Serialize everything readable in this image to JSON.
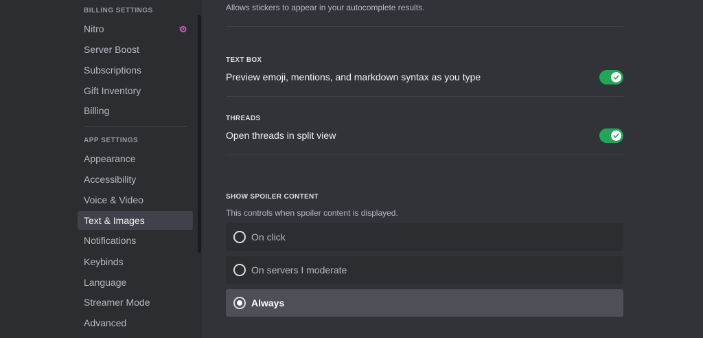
{
  "sidebar": {
    "billing_header": "BILLING SETTINGS",
    "billing_items": [
      {
        "label": "Nitro"
      },
      {
        "label": "Server Boost"
      },
      {
        "label": "Subscriptions"
      },
      {
        "label": "Gift Inventory"
      },
      {
        "label": "Billing"
      }
    ],
    "app_header": "APP SETTINGS",
    "app_items": [
      {
        "label": "Appearance"
      },
      {
        "label": "Accessibility"
      },
      {
        "label": "Voice & Video"
      },
      {
        "label": "Text & Images"
      },
      {
        "label": "Notifications"
      },
      {
        "label": "Keybinds"
      },
      {
        "label": "Language"
      },
      {
        "label": "Streamer Mode"
      },
      {
        "label": "Advanced"
      }
    ],
    "selected": "Text & Images",
    "nitro_icon": "nitro-icon"
  },
  "main": {
    "stickers_hint": "Allows stickers to appear in your autocomplete results.",
    "text_box": {
      "heading": "TEXT BOX",
      "label": "Preview emoji, mentions, and markdown syntax as you type",
      "enabled": true
    },
    "threads": {
      "heading": "THREADS",
      "label": "Open threads in split view",
      "enabled": true
    },
    "spoiler": {
      "heading": "SHOW SPOILER CONTENT",
      "description": "This controls when spoiler content is displayed.",
      "options": [
        {
          "label": "On click"
        },
        {
          "label": "On servers I moderate"
        },
        {
          "label": "Always"
        }
      ],
      "selected": "Always"
    }
  },
  "colors": {
    "toggle_on": "#23a55a",
    "nitro_accent": "#d957c9"
  }
}
